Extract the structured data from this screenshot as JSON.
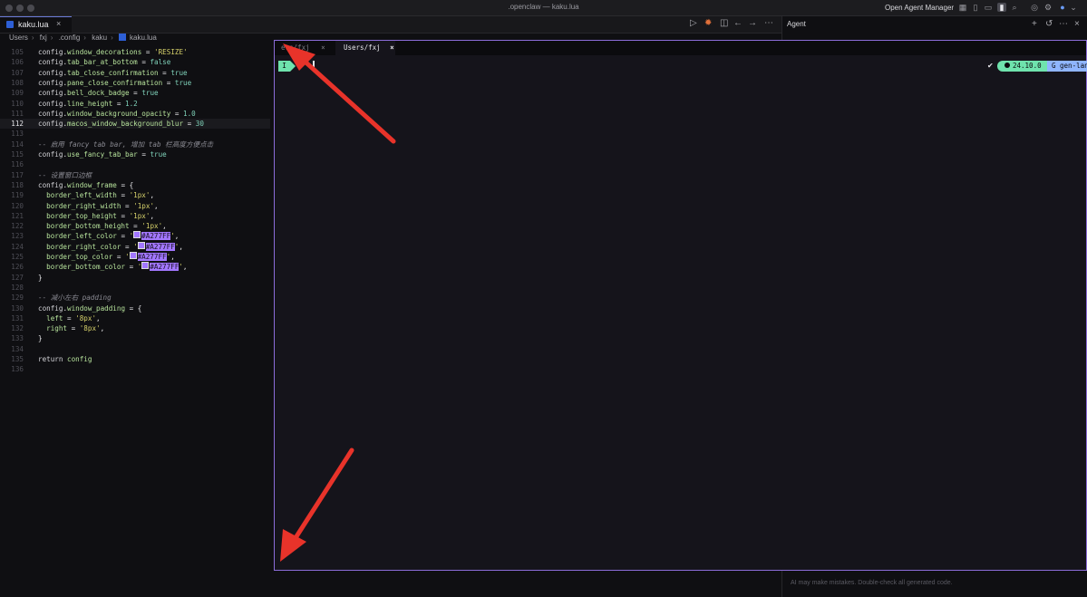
{
  "window": {
    "title": ".openclaw — kaku.lua",
    "agent_manager": "Open Agent Manager"
  },
  "tab": {
    "label": "kaku.lua",
    "close": "×"
  },
  "breadcrumb": [
    "Users",
    "fxj",
    ".config",
    "kaku",
    "kaku.lua"
  ],
  "editor": {
    "current_line": 112,
    "lines": [
      {
        "num": "105",
        "code": [
          {
            "t": "k",
            "v": "config"
          },
          {
            "t": "p",
            "v": "."
          },
          {
            "t": "x",
            "v": "window_decorations"
          },
          {
            "t": "p",
            "v": " = "
          },
          {
            "t": "s",
            "v": "'RESIZE'"
          }
        ]
      },
      {
        "num": "106",
        "code": [
          {
            "t": "k",
            "v": "config"
          },
          {
            "t": "p",
            "v": "."
          },
          {
            "t": "x",
            "v": "tab_bar_at_bottom"
          },
          {
            "t": "p",
            "v": " = "
          },
          {
            "t": "n",
            "v": "false"
          }
        ]
      },
      {
        "num": "107",
        "code": [
          {
            "t": "k",
            "v": "config"
          },
          {
            "t": "p",
            "v": "."
          },
          {
            "t": "x",
            "v": "tab_close_confirmation"
          },
          {
            "t": "p",
            "v": " = "
          },
          {
            "t": "n",
            "v": "true"
          }
        ]
      },
      {
        "num": "108",
        "code": [
          {
            "t": "k",
            "v": "config"
          },
          {
            "t": "p",
            "v": "."
          },
          {
            "t": "x",
            "v": "pane_close_confirmation"
          },
          {
            "t": "p",
            "v": " = "
          },
          {
            "t": "n",
            "v": "true"
          }
        ]
      },
      {
        "num": "109",
        "code": [
          {
            "t": "k",
            "v": "config"
          },
          {
            "t": "p",
            "v": "."
          },
          {
            "t": "x",
            "v": "bell_dock_badge"
          },
          {
            "t": "p",
            "v": " = "
          },
          {
            "t": "n",
            "v": "true"
          }
        ]
      },
      {
        "num": "110",
        "code": [
          {
            "t": "k",
            "v": "config"
          },
          {
            "t": "p",
            "v": "."
          },
          {
            "t": "x",
            "v": "line_height"
          },
          {
            "t": "p",
            "v": " = "
          },
          {
            "t": "n",
            "v": "1.2"
          }
        ]
      },
      {
        "num": "111",
        "code": [
          {
            "t": "k",
            "v": "config"
          },
          {
            "t": "p",
            "v": "."
          },
          {
            "t": "x",
            "v": "window_background_opacity"
          },
          {
            "t": "p",
            "v": " = "
          },
          {
            "t": "n",
            "v": "1.0"
          }
        ]
      },
      {
        "num": "112",
        "code": [
          {
            "t": "k",
            "v": "config"
          },
          {
            "t": "p",
            "v": "."
          },
          {
            "t": "x",
            "v": "macos_window_background_blur"
          },
          {
            "t": "p",
            "v": " = "
          },
          {
            "t": "n",
            "v": "30"
          }
        ]
      },
      {
        "num": "113",
        "code": []
      },
      {
        "num": "114",
        "code": [
          {
            "t": "c",
            "v": "-- 启用 fancy tab bar, 增加 tab 栏高度方便点击"
          }
        ]
      },
      {
        "num": "115",
        "code": [
          {
            "t": "k",
            "v": "config"
          },
          {
            "t": "p",
            "v": "."
          },
          {
            "t": "x",
            "v": "use_fancy_tab_bar"
          },
          {
            "t": "p",
            "v": " = "
          },
          {
            "t": "n",
            "v": "true"
          }
        ]
      },
      {
        "num": "116",
        "code": []
      },
      {
        "num": "117",
        "code": [
          {
            "t": "c",
            "v": "-- 设置窗口边框"
          }
        ]
      },
      {
        "num": "118",
        "code": [
          {
            "t": "k",
            "v": "config"
          },
          {
            "t": "p",
            "v": "."
          },
          {
            "t": "x",
            "v": "window_frame"
          },
          {
            "t": "p",
            "v": " = {"
          }
        ]
      },
      {
        "num": "119",
        "code": [
          {
            "t": "x",
            "v": "  border_left_width"
          },
          {
            "t": "p",
            "v": " = "
          },
          {
            "t": "s",
            "v": "'1px'"
          },
          {
            "t": "p",
            "v": ","
          }
        ]
      },
      {
        "num": "120",
        "code": [
          {
            "t": "x",
            "v": "  border_right_width"
          },
          {
            "t": "p",
            "v": " = "
          },
          {
            "t": "s",
            "v": "'1px'"
          },
          {
            "t": "p",
            "v": ","
          }
        ]
      },
      {
        "num": "121",
        "code": [
          {
            "t": "x",
            "v": "  border_top_height"
          },
          {
            "t": "p",
            "v": " = "
          },
          {
            "t": "s",
            "v": "'1px'"
          },
          {
            "t": "p",
            "v": ","
          }
        ]
      },
      {
        "num": "122",
        "code": [
          {
            "t": "x",
            "v": "  border_bottom_height"
          },
          {
            "t": "p",
            "v": " = "
          },
          {
            "t": "s",
            "v": "'1px'"
          },
          {
            "t": "p",
            "v": ","
          }
        ]
      },
      {
        "num": "123",
        "code": [
          {
            "t": "x",
            "v": "  border_left_color"
          },
          {
            "t": "p",
            "v": " = "
          },
          {
            "t": "s",
            "v": "'"
          },
          {
            "t": "sw",
            "v": ""
          },
          {
            "t": "hl",
            "v": "#A277FF"
          },
          {
            "t": "s",
            "v": "'"
          },
          {
            "t": "p",
            "v": ","
          }
        ]
      },
      {
        "num": "124",
        "code": [
          {
            "t": "x",
            "v": "  border_right_color"
          },
          {
            "t": "p",
            "v": " = "
          },
          {
            "t": "s",
            "v": "'"
          },
          {
            "t": "sw",
            "v": ""
          },
          {
            "t": "hl",
            "v": "#A277FF"
          },
          {
            "t": "s",
            "v": "'"
          },
          {
            "t": "p",
            "v": ","
          }
        ]
      },
      {
        "num": "125",
        "code": [
          {
            "t": "x",
            "v": "  border_top_color"
          },
          {
            "t": "p",
            "v": " = "
          },
          {
            "t": "s",
            "v": "'"
          },
          {
            "t": "sw",
            "v": ""
          },
          {
            "t": "hl",
            "v": "#A277FF"
          },
          {
            "t": "s",
            "v": "'"
          },
          {
            "t": "p",
            "v": ","
          }
        ]
      },
      {
        "num": "126",
        "code": [
          {
            "t": "x",
            "v": "  border_bottom_color"
          },
          {
            "t": "p",
            "v": " = "
          },
          {
            "t": "s",
            "v": "'"
          },
          {
            "t": "sw",
            "v": ""
          },
          {
            "t": "hl",
            "v": "#A277FF"
          },
          {
            "t": "s",
            "v": "'"
          },
          {
            "t": "p",
            "v": ","
          }
        ]
      },
      {
        "num": "127",
        "code": [
          {
            "t": "p",
            "v": "}"
          }
        ]
      },
      {
        "num": "128",
        "code": []
      },
      {
        "num": "129",
        "code": [
          {
            "t": "c",
            "v": "-- 减小左右 padding"
          }
        ]
      },
      {
        "num": "130",
        "code": [
          {
            "t": "k",
            "v": "config"
          },
          {
            "t": "p",
            "v": "."
          },
          {
            "t": "x",
            "v": "window_padding"
          },
          {
            "t": "p",
            "v": " = {"
          }
        ]
      },
      {
        "num": "131",
        "code": [
          {
            "t": "x",
            "v": "  left"
          },
          {
            "t": "p",
            "v": " = "
          },
          {
            "t": "s",
            "v": "'8px'"
          },
          {
            "t": "p",
            "v": ","
          }
        ]
      },
      {
        "num": "132",
        "code": [
          {
            "t": "x",
            "v": "  right"
          },
          {
            "t": "p",
            "v": " = "
          },
          {
            "t": "s",
            "v": "'8px'"
          },
          {
            "t": "p",
            "v": ","
          }
        ]
      },
      {
        "num": "133",
        "code": [
          {
            "t": "p",
            "v": "}"
          }
        ]
      },
      {
        "num": "134",
        "code": []
      },
      {
        "num": "135",
        "code": [
          {
            "t": "k",
            "v": "return"
          },
          {
            "t": "p",
            "v": " "
          },
          {
            "t": "x",
            "v": "config"
          }
        ]
      },
      {
        "num": "136",
        "code": []
      }
    ]
  },
  "terminal": {
    "tabs": [
      {
        "label": "ers/fxj",
        "close": "×",
        "active": false
      },
      {
        "label": "Users/fxj",
        "close": "×",
        "active": true
      }
    ],
    "prompt_mode": "I",
    "status_check": "✔",
    "node_version": "24.10.0",
    "project_badge": "G gen-lan",
    "border_color": "#8b6cd8"
  },
  "agent_panel": {
    "title": "Agent",
    "footer": "AI may make mistakes. Double-check all generated code."
  },
  "annotations": {
    "arrow_color": "#e8332a"
  },
  "colors": {
    "accent_purple": "#A277FF",
    "node_green": "#6fe3ad",
    "badge_blue": "#8fb5ff"
  }
}
